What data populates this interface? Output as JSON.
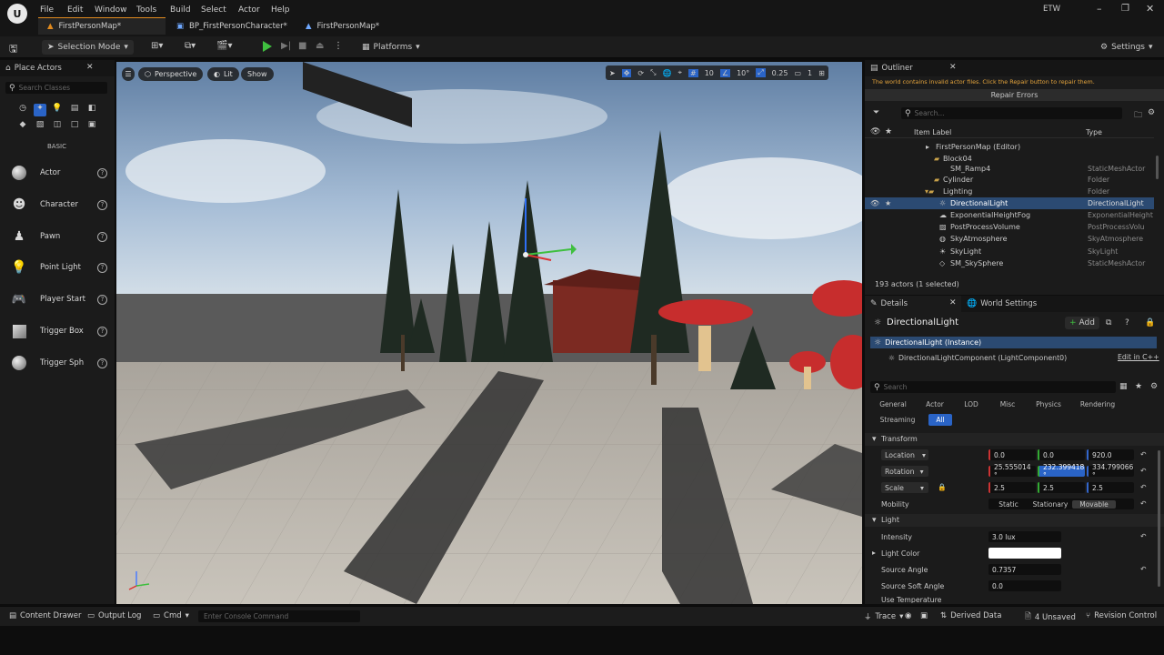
{
  "menu": {
    "file": "File",
    "edit": "Edit",
    "window": "Window",
    "tools": "Tools",
    "build": "Build",
    "select": "Select",
    "actor": "Actor",
    "help": "Help"
  },
  "user_badge": "ETW",
  "tabs": [
    {
      "label": "FirstPersonMap*"
    },
    {
      "label": "BP_FirstPersonCharacter*"
    },
    {
      "label": "FirstPersonMap*"
    }
  ],
  "toolbar": {
    "selection_mode": "Selection Mode",
    "platforms": "Platforms",
    "settings": "Settings"
  },
  "place_actors": {
    "title": "Place Actors",
    "search_placeholder": "Search Classes",
    "category": "BASIC",
    "items": [
      {
        "label": "Actor"
      },
      {
        "label": "Character"
      },
      {
        "label": "Pawn"
      },
      {
        "label": "Point Light"
      },
      {
        "label": "Player Start"
      },
      {
        "label": "Trigger Box"
      },
      {
        "label": "Trigger Sph"
      }
    ]
  },
  "viewport": {
    "perspective": "Perspective",
    "lit": "Lit",
    "show": "Show",
    "grid_snap": "10",
    "rot_snap": "10°",
    "scale_snap": "0.25",
    "camera_speed": "1"
  },
  "outliner": {
    "title": "Outliner",
    "warning": "The world contains invalid actor files. Click the Repair button to repair them.",
    "repair_button": "Repair Errors",
    "search_placeholder": "Search...",
    "col_label": "Item Label",
    "col_type": "Type",
    "rows": [
      {
        "label": "FirstPersonMap (Editor)",
        "type": ""
      },
      {
        "label": "Block04",
        "type": ""
      },
      {
        "label": "SM_Ramp4",
        "type": "StaticMeshActor"
      },
      {
        "label": "Cylinder",
        "type": "Folder"
      },
      {
        "label": "Lighting",
        "type": "Folder"
      },
      {
        "label": "DirectionalLight",
        "type": "DirectionalLight"
      },
      {
        "label": "ExponentialHeightFog",
        "type": "ExponentialHeight"
      },
      {
        "label": "PostProcessVolume",
        "type": "PostProcessVolu"
      },
      {
        "label": "SkyAtmosphere",
        "type": "SkyAtmosphere"
      },
      {
        "label": "SkyLight",
        "type": "SkyLight"
      },
      {
        "label": "SM_SkySphere",
        "type": "StaticMeshActor"
      }
    ],
    "count": "193 actors (1 selected)"
  },
  "details": {
    "tab_details": "Details",
    "tab_world": "World Settings",
    "actor_name": "DirectionalLight",
    "add_button": "Add",
    "instance": "DirectionalLight (Instance)",
    "component": "DirectionalLightComponent (LightComponent0)",
    "edit_cpp": "Edit in C++",
    "search_placeholder": "Search",
    "categories": [
      "General",
      "Actor",
      "LOD",
      "Misc",
      "Physics",
      "Rendering"
    ],
    "categories2": [
      "Streaming",
      "All"
    ],
    "transform": {
      "title": "Transform",
      "location_label": "Location",
      "location": [
        "0.0",
        "0.0",
        "920.0"
      ],
      "rotation_label": "Rotation",
      "rotation": [
        "25.555014 °",
        "232.399418 °",
        "334.799066 °"
      ],
      "scale_label": "Scale",
      "scale": [
        "2.5",
        "2.5",
        "2.5"
      ],
      "mobility_label": "Mobility",
      "mobility": [
        "Static",
        "Stationary",
        "Movable"
      ]
    },
    "light": {
      "title": "Light",
      "intensity_label": "Intensity",
      "intensity": "3.0 lux",
      "color_label": "Light Color",
      "source_angle_label": "Source Angle",
      "source_angle": "0.7357",
      "soft_angle_label": "Source Soft Angle",
      "soft_angle": "0.0",
      "use_temp_label": "Use Temperature"
    }
  },
  "statusbar": {
    "content_drawer": "Content Drawer",
    "output_log": "Output Log",
    "cmd": "Cmd",
    "console_placeholder": "Enter Console Command",
    "trace": "Trace",
    "derived_data": "Derived Data",
    "unsaved": "4 Unsaved",
    "revision": "Revision Control"
  },
  "colors": {
    "accent": "#e08a1e",
    "selection": "#2b4a72",
    "play_green": "#3fbf3f",
    "warning_text": "#e3a33c"
  }
}
